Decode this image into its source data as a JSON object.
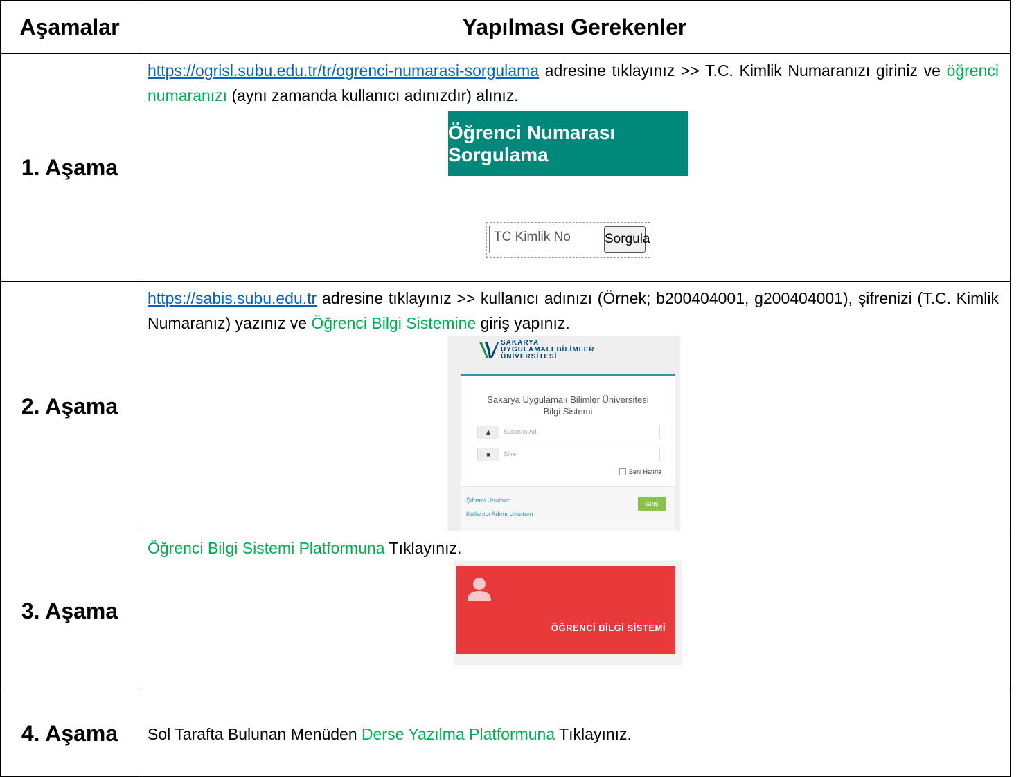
{
  "table": {
    "header": {
      "col1": "Aşamalar",
      "col2": "Yapılması Gerekenler"
    },
    "rows": [
      {
        "stage": "1. Aşama",
        "link": "https://ogrisl.subu.edu.tr/tr/ogrenci-numarasi-sorgulama",
        "text_a": " adresine tıklayınız >> T.C. Kimlik Numaranızı giriniz ve ",
        "highlight": "öğrenci numaranızı",
        "text_b": " (aynı zamanda kullanıcı adınızdır) alınız.",
        "screenshot": {
          "banner_title": "Öğrenci Numarası Sorgulama",
          "banner_color": "#00897B",
          "input_placeholder": "TC Kimlik No",
          "button_label": "Sorgula"
        }
      },
      {
        "stage": "2. Aşama",
        "link": "https://sabis.subu.edu.tr",
        "text_a": " adresine tıklayınız >> kullanıcı adınızı (Örnek; b200404001, g200404001), şifrenizi (T.C. Kimlik Numaranız) yazınız ve ",
        "highlight": "Öğrenci Bilgi Sistemine",
        "text_b": " giriş yapınız.",
        "screenshot": {
          "logo_line1": "SAKARYA",
          "logo_line2": "UYGULAMALI BİLİMLER",
          "logo_line3": "ÜNİVERSİTESİ",
          "panel_title_1": "Sakarya Uygulamalı Bilimler Üniversitesi",
          "panel_title_2": "Bilgi Sistemi",
          "username_placeholder": "Kullanıcı Adı",
          "password_placeholder": "Şifre",
          "remember_label": "Beni Hatırla",
          "forgot_password": "Şifremi Unuttum",
          "forgot_username": "Kullanıcı Adımı Unuttum",
          "login_button": "Giriş"
        }
      },
      {
        "stage": "3. Aşama",
        "highlight": "Öğrenci Bilgi Sistemi Platformuna",
        "text_b": " Tıklayınız.",
        "screenshot": {
          "tile_label": "ÖĞRENCİ BİLGİ SİSTEMİ",
          "tile_color": "#E8393B"
        }
      },
      {
        "stage": "4. Aşama",
        "text_a": "Sol Tarafta Bulunan Menüden ",
        "highlight": "Derse Yazılma Platformuna",
        "text_b": " Tıklayınız."
      }
    ]
  },
  "colors": {
    "link": "#0563C1",
    "highlight": "#00B050"
  }
}
